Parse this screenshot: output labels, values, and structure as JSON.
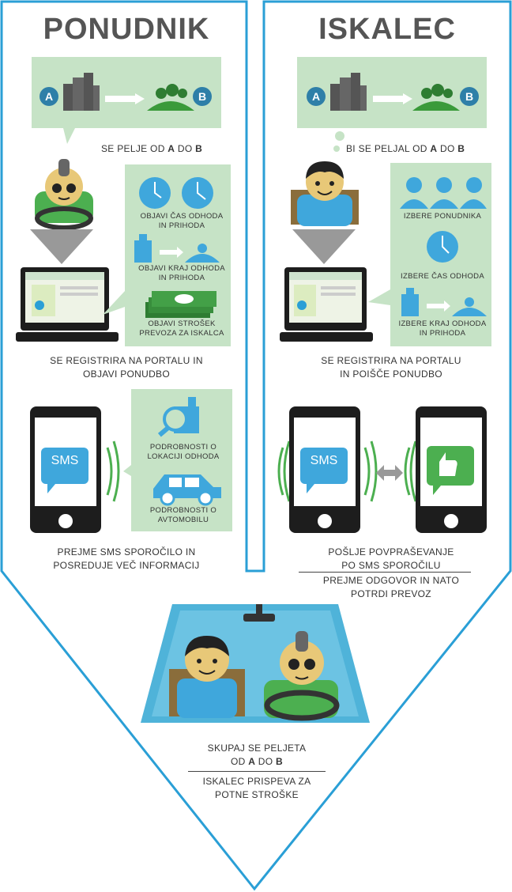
{
  "columns": {
    "left": {
      "title": "PONUDNIK",
      "route_text": "SE PELJE OD ",
      "route_a": "A",
      "route_mid": " DO ",
      "route_b": "B",
      "bubble_items": [
        {
          "label1": "OBJAVI ČAS ODHODA",
          "label2": "IN PRIHODA",
          "icon": "clock-icon"
        },
        {
          "label1": "OBJAVI KRAJ ODHODA",
          "label2": "IN PRIHODA",
          "icon": "route-icon"
        },
        {
          "label1": "OBJAVI STROŠEK",
          "label2": "PREVOZA ZA ISKALCA",
          "icon": "money-icon"
        }
      ],
      "portal_text1": "SE REGISTRIRA NA PORTALU IN",
      "portal_text2": "OBJAVI PONUDBO",
      "sms_label": "SMS",
      "sms_items": [
        {
          "label1": "PODROBNOSTI O",
          "label2": "LOKACIJI ODHODA",
          "icon": "location-search-icon"
        },
        {
          "label1": "PODROBNOSTI O",
          "label2": "AVTOMOBILU",
          "icon": "car-icon"
        }
      ],
      "sms_text1": "PREJME SMS SPOROČILO IN",
      "sms_text2": "POSREDUJE VEČ INFORMACIJ"
    },
    "right": {
      "title": "ISKALEC",
      "route_text": "BI SE PELJAL OD ",
      "route_a": "A",
      "route_mid": " DO ",
      "route_b": "B",
      "bubble_items": [
        {
          "label1": "IZBERE PONUDNIKA",
          "label2": "",
          "icon": "people-icon"
        },
        {
          "label1": "IZBERE ČAS ODHODA",
          "label2": "",
          "icon": "clock-icon"
        },
        {
          "label1": "IZBERE KRAJ ODHODA",
          "label2": "IN PRIHODA",
          "icon": "route-icon"
        }
      ],
      "portal_text1": "SE REGISTRIRA NA PORTALU",
      "portal_text2": "IN POIŠČE PONUDBO",
      "sms_label": "SMS",
      "sms_text1": "POŠLJE POVPRAŠEVANJE",
      "sms_text2": "PO SMS SPOROČILU",
      "sms_text3": "PREJME ODGOVOR IN NATO",
      "sms_text4": "POTRDI PREVOZ"
    }
  },
  "markers": {
    "a": "A",
    "b": "B"
  },
  "bottom": {
    "line1": "SKUPAJ SE PELJETA",
    "line2_pre": "OD ",
    "line2_a": "A",
    "line2_mid": " DO ",
    "line2_b": "B",
    "line3": "ISKALEC PRISPEVA ZA",
    "line4": "POTNE STROŠKE"
  },
  "colors": {
    "outline": "#2a9fd6",
    "bubble": "#c6e3c6",
    "icon_blue": "#3fa7dc",
    "green": "#4caf50",
    "title": "#555555",
    "dark": "#222222"
  }
}
